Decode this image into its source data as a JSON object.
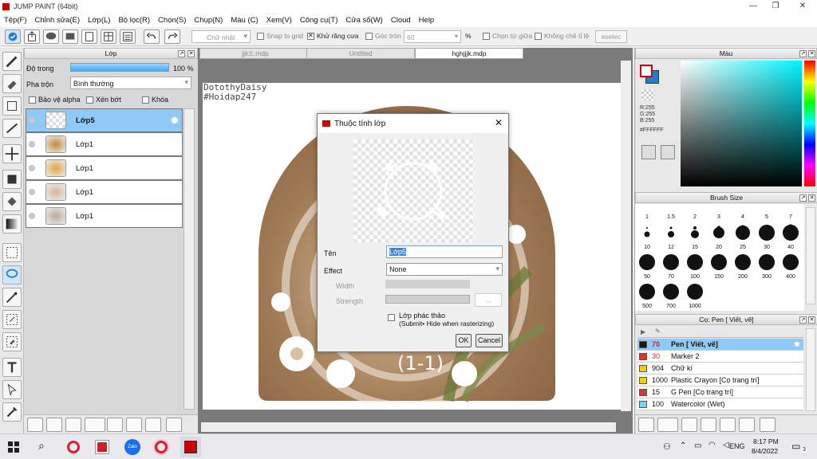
{
  "window": {
    "title": "JUMP PAINT (64bit)"
  },
  "menu": [
    "Tệp(F)",
    "Chỉnh sửa(E)",
    "Lớp(L)",
    "Bộ lọc(R)",
    "Chọn(S)",
    "Chụp(N)",
    "Màu (C)",
    "Xem(V)",
    "Công cụ(T)",
    "Cửa sổ(W)",
    "Cloud",
    "Help"
  ],
  "toolbar": {
    "shape_select": "Chữ nhật",
    "snap_to_grid": "Snap to grid",
    "anti_alias": "Khử răng cưa",
    "round_corner": "Góc tròn",
    "round_value": "60",
    "percent": "%",
    "center_select": "Chọn từ giữa",
    "aspect_lock": "Không chế tỉ lệ",
    "deselect": "eselec"
  },
  "layer_panel": {
    "title": "Lớp",
    "opacity_label": "Độ trong",
    "opacity_value": "100 %",
    "blend_label": "Pha trộn",
    "blend_value": "Bình thường",
    "protect_alpha": "Bảo vệ alpha",
    "clipping": "Xén bớt",
    "lock": "Khóa",
    "layers": [
      {
        "name": "Lớp5",
        "selected": true
      },
      {
        "name": "Lớp1",
        "selected": false
      },
      {
        "name": "Lớp1",
        "selected": false
      },
      {
        "name": "Lớp1",
        "selected": false
      },
      {
        "name": "Lớp1",
        "selected": false
      }
    ]
  },
  "tabs": [
    "jjk;l;.mdp",
    "Untitled",
    "hghjjjk.mdp"
  ],
  "canvas_text": [
    "DotothyDaisy",
    "#Hoidap247"
  ],
  "dialog": {
    "title": "Thuộc tính lớp",
    "name_label": "Tên",
    "name_value": "Lớp5",
    "effect_label": "Effect",
    "effect_value": "None",
    "width_label": "Width",
    "strength_label": "Strength",
    "strength_btn": "...",
    "draft_label": "Lớp phác thảo",
    "draft_sub": "(Submit• Hide when rasterizing)",
    "ok": "OK",
    "cancel": "Cancel"
  },
  "color_panel": {
    "title": "Màu",
    "r": "R:255",
    "g": "G:255",
    "b": "B:255",
    "hex": "#FFFFFF"
  },
  "brush_panel": {
    "title": "Brush Size",
    "sizes": [
      "1",
      "1.5",
      "2",
      "3",
      "4",
      "5",
      "7",
      "10",
      "12",
      "15",
      "20",
      "25",
      "30",
      "40",
      "50",
      "70",
      "100",
      "150",
      "200",
      "300",
      "400",
      "500",
      "700",
      "1000"
    ]
  },
  "pen_panel": {
    "title": "Cọ: Pen [ Viết, vẽ]",
    "items": [
      {
        "size": "70",
        "name": "Pen [ Viết, vẽ]",
        "color": "#1a1a1a",
        "selected": true
      },
      {
        "size": "30",
        "name": "Marker 2",
        "color": "#e03030",
        "selected": false
      },
      {
        "size": "904",
        "name": "Chữ kí",
        "color": "#f0d000",
        "selected": false
      },
      {
        "size": "1000",
        "name": "Plastic Crayon [Cọ trang trí]",
        "color": "#f0d000",
        "selected": false
      },
      {
        "size": "15",
        "name": "G Pen [Cọ trang trí]",
        "color": "#e03030",
        "selected": false
      },
      {
        "size": "100",
        "name": "Watercolor (Wet)",
        "color": "#80d0f0",
        "selected": false
      }
    ]
  },
  "taskbar": {
    "lang": "ENG",
    "time": "8:17 PM",
    "date": "8/4/2022",
    "notif_count": "3"
  }
}
